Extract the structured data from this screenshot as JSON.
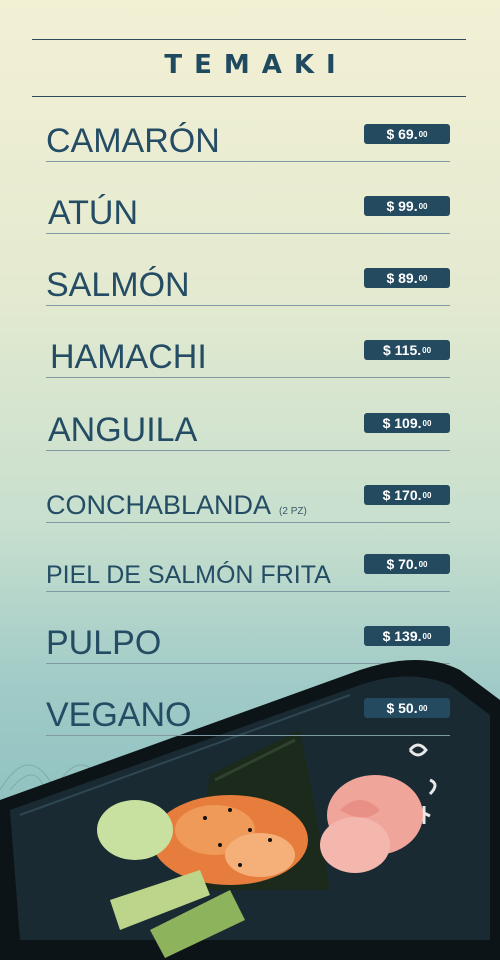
{
  "menu": {
    "title": "TEMAKI",
    "items": [
      {
        "name": "CAMARÓN",
        "price": "$ 69.",
        "cents": "00"
      },
      {
        "name": "ATÚN",
        "price": "$ 99.",
        "cents": "00"
      },
      {
        "name": "SALMÓN",
        "price": "$ 89.",
        "cents": "00"
      },
      {
        "name": "HAMACHI",
        "price": "$ 115.",
        "cents": "00"
      },
      {
        "name": "ANGUILA",
        "price": "$ 109.",
        "cents": "00"
      },
      {
        "name": "CONCHABLANDA",
        "note": "(2 PZ)",
        "price": "$ 170.",
        "cents": "00"
      },
      {
        "name": "PIEL DE SALMÓN FRITA",
        "price": "$ 70.",
        "cents": "00"
      },
      {
        "name": "PULPO",
        "price": "$ 139.",
        "cents": "00"
      },
      {
        "name": "VEGANO",
        "price": "$ 50.",
        "cents": "00"
      }
    ]
  },
  "image": {
    "icon": "temaki-hand-roll-photo"
  },
  "colors": {
    "accent": "#244a60",
    "text": "#244c64"
  }
}
